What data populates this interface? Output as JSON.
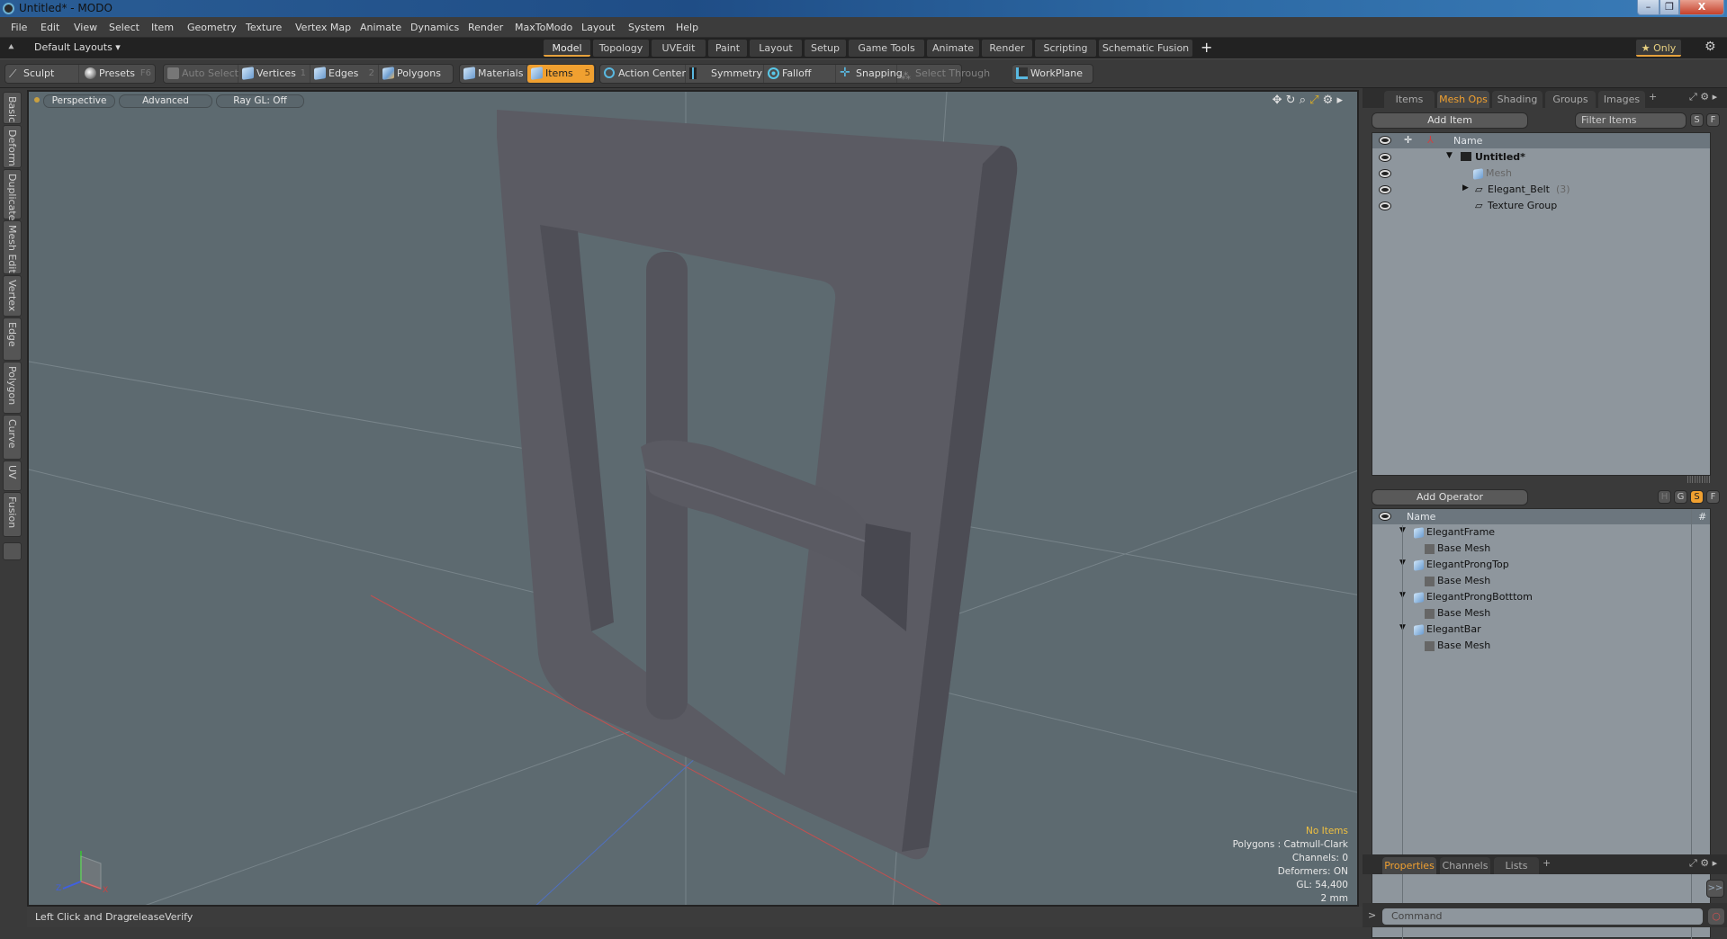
{
  "window": {
    "title": "Untitled* - MODO",
    "minimize": "–",
    "maximize": "❐",
    "close": "X"
  },
  "menu": [
    "File",
    "Edit",
    "View",
    "Select",
    "Item",
    "Geometry",
    "Texture",
    "Vertex Map",
    "Animate",
    "Dynamics",
    "Render",
    "MaxToModo",
    "Layout",
    "System",
    "Help"
  ],
  "layouts": {
    "dropdown": "Default Layouts ▾",
    "tabs": [
      "Model",
      "Topology",
      "UVEdit",
      "Paint",
      "Layout",
      "Setup",
      "Game Tools",
      "Animate",
      "Render",
      "Scripting",
      "Schematic Fusion"
    ],
    "active": "Model",
    "add": "+",
    "only_label": "★ Only"
  },
  "toolbar": {
    "sculpt": "Sculpt",
    "presets": "Presets",
    "presets_key": "F6",
    "auto_select": "Auto Select",
    "vertices": "Vertices",
    "vertices_key": "1",
    "edges": "Edges",
    "edges_key": "2",
    "polygons": "Polygons",
    "materials": "Materials",
    "items": "Items",
    "items_key": "5",
    "action_center": "Action Center",
    "symmetry": "Symmetry",
    "falloff": "Falloff",
    "snapping": "Snapping",
    "select_through": "Select Through",
    "workplane": "WorkPlane"
  },
  "left_tabs": [
    "Basic",
    "Deform",
    "Duplicate",
    "Mesh Edit",
    "Vertex",
    "Edge",
    "Polygon",
    "Curve",
    "UV",
    "Fusion"
  ],
  "viewport": {
    "view": "Perspective",
    "shading": "Advanced",
    "raygl": "Ray GL: Off",
    "info": {
      "selection": "No Items",
      "polygons": "Polygons : Catmull-Clark",
      "channels": "Channels: 0",
      "deformers": "Deformers: ON",
      "gl": "GL: 54,400",
      "scale": "2 mm"
    },
    "axis": {
      "x": "X",
      "y": "Y",
      "z": "Z"
    }
  },
  "items_panel": {
    "tabs": [
      "Items",
      "Mesh Ops",
      "Shading",
      "Groups",
      "Images"
    ],
    "active": "Mesh Ops",
    "add_item": "Add Item",
    "filter_placeholder": "Filter Items",
    "s": "S",
    "f": "F",
    "column_name": "Name",
    "tree": [
      {
        "label": "Untitled*",
        "bold": true,
        "expand": "▼"
      },
      {
        "label": "Mesh",
        "dim": true
      },
      {
        "label": "Elegant_Belt",
        "count": "(3)",
        "expand": "▶"
      },
      {
        "label": "Texture Group"
      }
    ]
  },
  "meshops_panel": {
    "add_operator": "Add Operator",
    "h": "H",
    "g": "G",
    "s": "S",
    "f": "F",
    "column_name": "Name",
    "column_hash": "#",
    "tree": [
      {
        "label": "ElegantFrame",
        "child": "Base Mesh"
      },
      {
        "label": "ElegantProngTop",
        "child": "Base Mesh"
      },
      {
        "label": "ElegantProngBotttom",
        "child": "Base Mesh"
      },
      {
        "label": "ElegantBar",
        "child": "Base Mesh"
      }
    ]
  },
  "properties_panel": {
    "tabs": [
      "Properties",
      "Channels",
      "Lists"
    ],
    "active": "Properties",
    "expand_btn": ">>"
  },
  "command": {
    "prompt": ">",
    "placeholder": "Command"
  },
  "status": {
    "label": "Left Click and Drag:",
    "value": "releaseVerify"
  },
  "colors": {
    "accent": "#f0a030",
    "viewport_bg": "#5d6a70",
    "list_bg": "#8e969d"
  }
}
